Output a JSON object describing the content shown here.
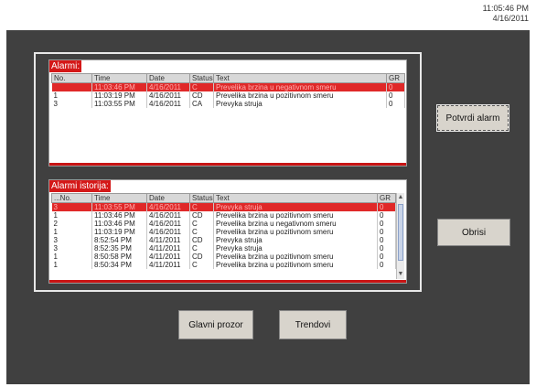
{
  "clock": {
    "time": "11:05:46 PM",
    "date": "4/16/2011"
  },
  "alarms": {
    "title": "Alarmi:",
    "columns": [
      "No.",
      "Time",
      "Date",
      "Status",
      "Text",
      "GR"
    ],
    "rows": [
      [
        "",
        "11:03:46 PM",
        "4/16/2011",
        "C",
        "Prevelika brzina u negativnom smeru",
        "0"
      ],
      [
        "1",
        "11:03:19 PM",
        "4/16/2011",
        "CD",
        "Prevelika brzina u pozitivnom smeru",
        "0"
      ],
      [
        "3",
        "11:03:55 PM",
        "4/16/2011",
        "CA",
        "Prevyka struja",
        "0"
      ]
    ]
  },
  "history": {
    "title": "Alarmi istorija:",
    "columns": [
      "...No.",
      "Time",
      "Date",
      "Status",
      "Text",
      "GR"
    ],
    "rows": [
      [
        "3",
        "11:03:55 PM",
        "4/16/2011",
        "C",
        "Prevyka struja",
        "0"
      ],
      [
        "1",
        "11:03:46 PM",
        "4/16/2011",
        "CD",
        "Prevelika brzina u pozitivnom smeru",
        "0"
      ],
      [
        "2",
        "11:03:46 PM",
        "4/16/2011",
        "C",
        "Prevelika brzina u negativnom smeru",
        "0"
      ],
      [
        "1",
        "11:03:19 PM",
        "4/16/2011",
        "C",
        "Prevelika brzina u pozitivnom smeru",
        "0"
      ],
      [
        "3",
        "8:52:54 PM",
        "4/11/2011",
        "CD",
        "Prevyka struja",
        "0"
      ],
      [
        "3",
        "8:52:35 PM",
        "4/11/2011",
        "C",
        "Prevyka struja",
        "0"
      ],
      [
        "1",
        "8:50:58 PM",
        "4/11/2011",
        "CD",
        "Prevelika brzina u pozitivnom smeru",
        "0"
      ],
      [
        "1",
        "8:50:34 PM",
        "4/11/2011",
        "C",
        "Prevelika brzina u pozitivnom smeru",
        "0"
      ]
    ]
  },
  "buttons": {
    "acknowledge": "Potvrdi alarm",
    "delete": "Obrisi",
    "main_window": "Glavni prozor",
    "trends": "Trendovi"
  },
  "colors": {
    "alarm_red": "#d41818",
    "background": "#404040"
  }
}
